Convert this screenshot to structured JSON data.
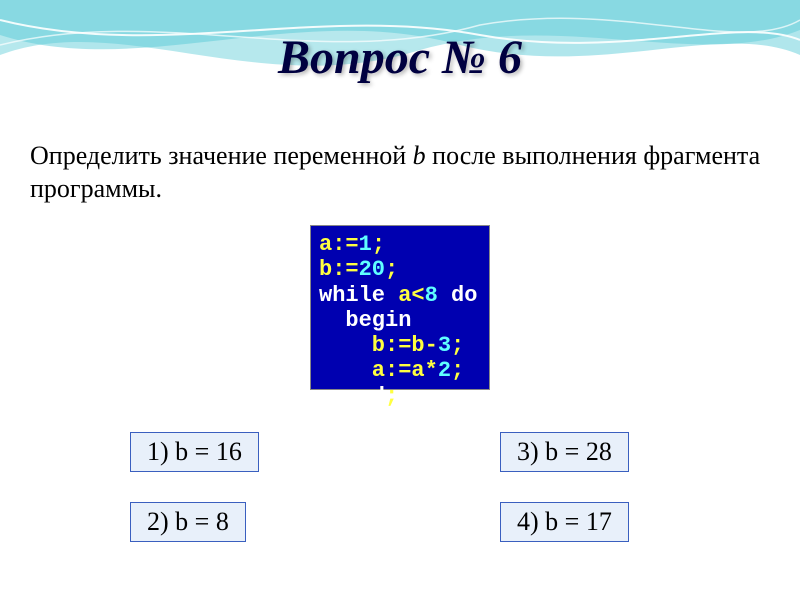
{
  "heading": "Вопрос № 6",
  "question": {
    "prefix": "Определить значение переменной ",
    "var": "b",
    "suffix": " после выполнения фрагмента программы."
  },
  "code": {
    "l1a": "a:=",
    "l1b": "1",
    "l1c": ";",
    "l2a": "b:=",
    "l2b": "20",
    "l2c": ";",
    "l3a": "while ",
    "l3b": "a<",
    "l3c": "8",
    "l3d": " do",
    "l4": "  begin",
    "l5a": "    b:=b-",
    "l5b": "3",
    "l5c": ";",
    "l6a": "    a:=a*",
    "l6b": "2",
    "l6c": ";",
    "l7a": "  end",
    "l7b": ";"
  },
  "answers": {
    "a1": "1) b = 16",
    "a2": "2) b = 8",
    "a3": "3) b = 28",
    "a4": "4) b = 17"
  }
}
